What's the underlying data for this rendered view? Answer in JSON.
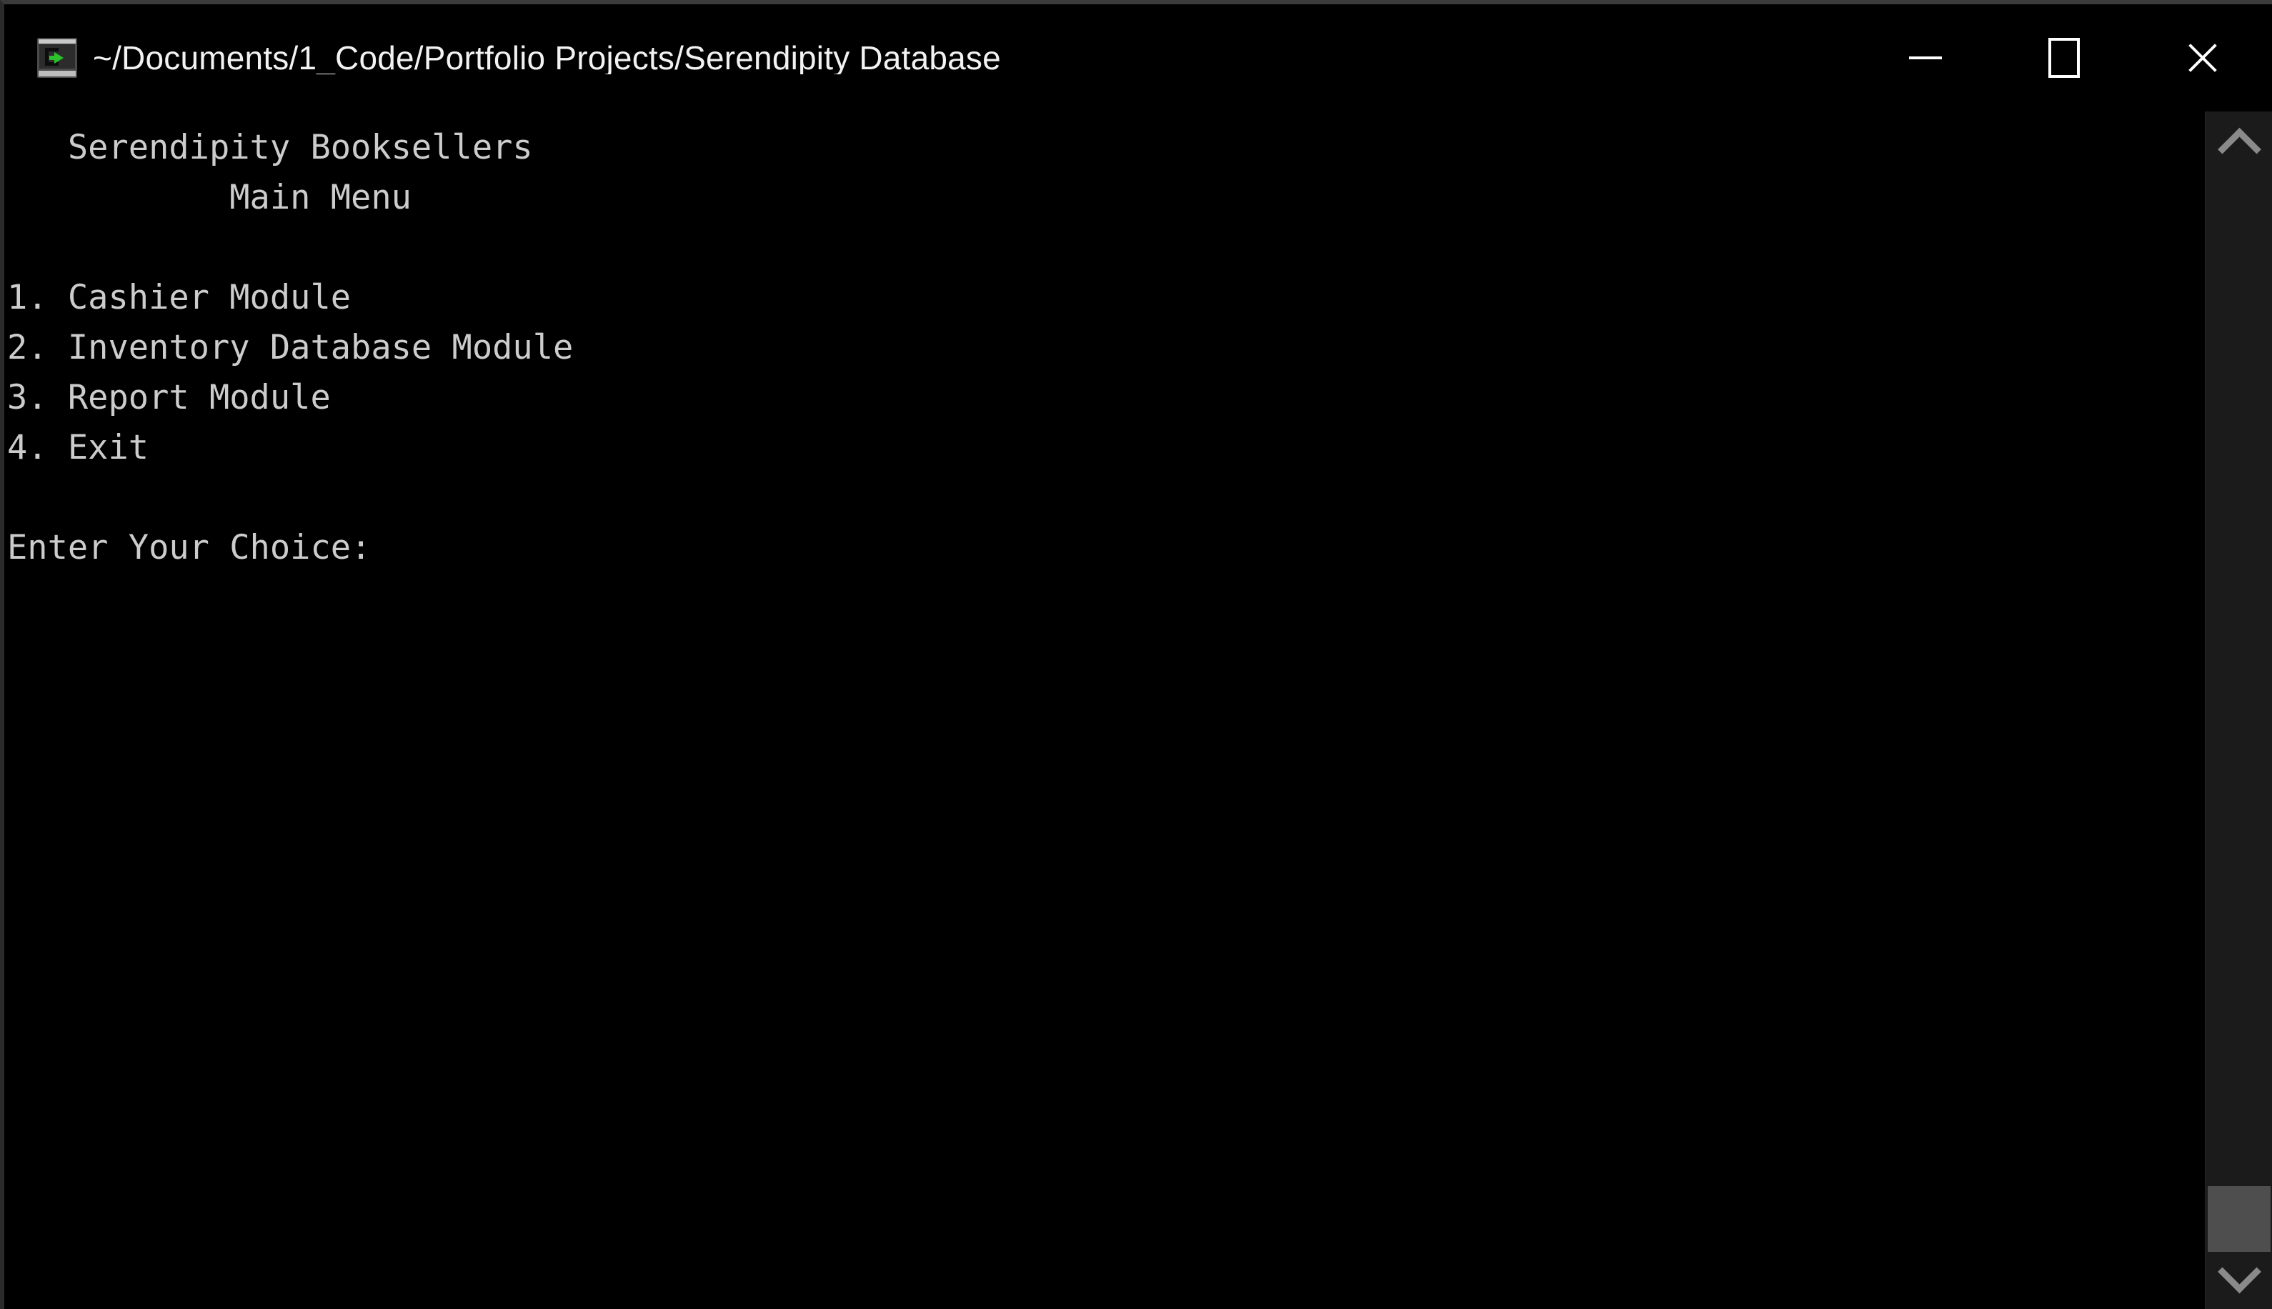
{
  "window": {
    "title": "~/Documents/1_Code/Portfolio Projects/Serendipity Database",
    "icon": "terminal-console-icon",
    "background_color": "#000000",
    "border_color": "#3b3b3b"
  },
  "titlebar": {
    "minimize_label": "—",
    "maximize_label": "□",
    "close_label": "✕",
    "minimize_icon": "minimize-icon",
    "maximize_icon": "maximize-icon",
    "close_icon": "close-icon"
  },
  "terminal": {
    "foreground_color": "#cccccc",
    "background_color": "#000000",
    "lines": [
      "   Serendipity Booksellers",
      "           Main Menu",
      "",
      "1. Cashier Module",
      "2. Inventory Database Module",
      "3. Report Module",
      "4. Exit",
      "",
      "Enter Your Choice: "
    ],
    "heading": "Serendipity Booksellers",
    "subheading": "Main Menu",
    "menu_items": [
      "1. Cashier Module",
      "2. Inventory Database Module",
      "3. Report Module",
      "4. Exit"
    ],
    "prompt": "Enter Your Choice:"
  },
  "scrollbar": {
    "up_arrow_icon": "chevron-up-icon",
    "down_arrow_icon": "chevron-down-icon",
    "thumb_color": "#4e4e4e",
    "track_color": "#1b1b1b"
  }
}
